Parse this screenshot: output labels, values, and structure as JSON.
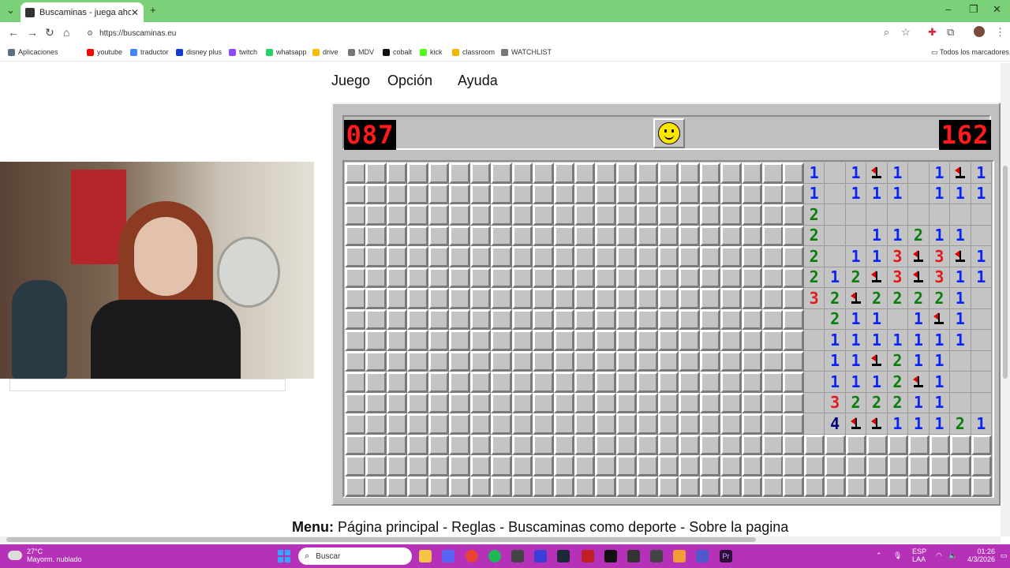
{
  "browser": {
    "tab_title": "Buscaminas - juega ahora!",
    "url": "https://buscaminas.eu",
    "bookmarks": [
      {
        "label": "Aplicaciones",
        "color": "#5b6f8a"
      },
      {
        "label": "youtube",
        "color": "#ff0000"
      },
      {
        "label": "traductor",
        "color": "#4285f4"
      },
      {
        "label": "disney plus",
        "color": "#113ccf"
      },
      {
        "label": "twitch",
        "color": "#9146ff"
      },
      {
        "label": "whatsapp",
        "color": "#25d366"
      },
      {
        "label": "drive",
        "color": "#fbbc04"
      },
      {
        "label": "MDV",
        "color": "#777777"
      },
      {
        "label": "cobalt",
        "color": "#111111"
      },
      {
        "label": "kick",
        "color": "#53fc18"
      },
      {
        "label": "classroom",
        "color": "#f4b400"
      },
      {
        "label": "WATCHLIST",
        "color": "#777777"
      }
    ],
    "all_bookmarks": "Todos los marcadores"
  },
  "page": {
    "menu": [
      "Juego",
      "Opción",
      "Ayuda"
    ],
    "bottom_menu_label": "Menu:",
    "bottom_menu_links": "Página principal - Reglas - Buscaminas como deporte - Sobre la pagina"
  },
  "game": {
    "mines_counter": "087",
    "timer": "162",
    "face": "smile",
    "cols": 31,
    "rows": 16,
    "number_colors": {
      "1": "#0b24f5",
      "2": "#0a7d0a",
      "3": "#e31919",
      "4": "#00007b"
    },
    "revealed": [
      "__________________________1_1F1_1F1",
      "__________________________1_111_111",
      "__________________________2________",
      "__________________________2__11211",
      "__________________________2_113F3F1",
      "__________________________212F3F311",
      "__________________________32F22221_",
      "___________________________211_1F1_",
      "___________________________1111111_",
      "___________________________11F211__",
      "___________________________1112F1__",
      "___________________________322211__",
      "___________________________4FF11121",
      "___________________________________",
      "___________________________________",
      "___________________________________"
    ]
  },
  "taskbar": {
    "weather_temp": "27°C",
    "weather_desc": "Mayorm. nublado",
    "search_placeholder": "Buscar",
    "lang1": "ESP",
    "lang2": "LAA",
    "time": "01:26",
    "date": "4/3/2026"
  }
}
